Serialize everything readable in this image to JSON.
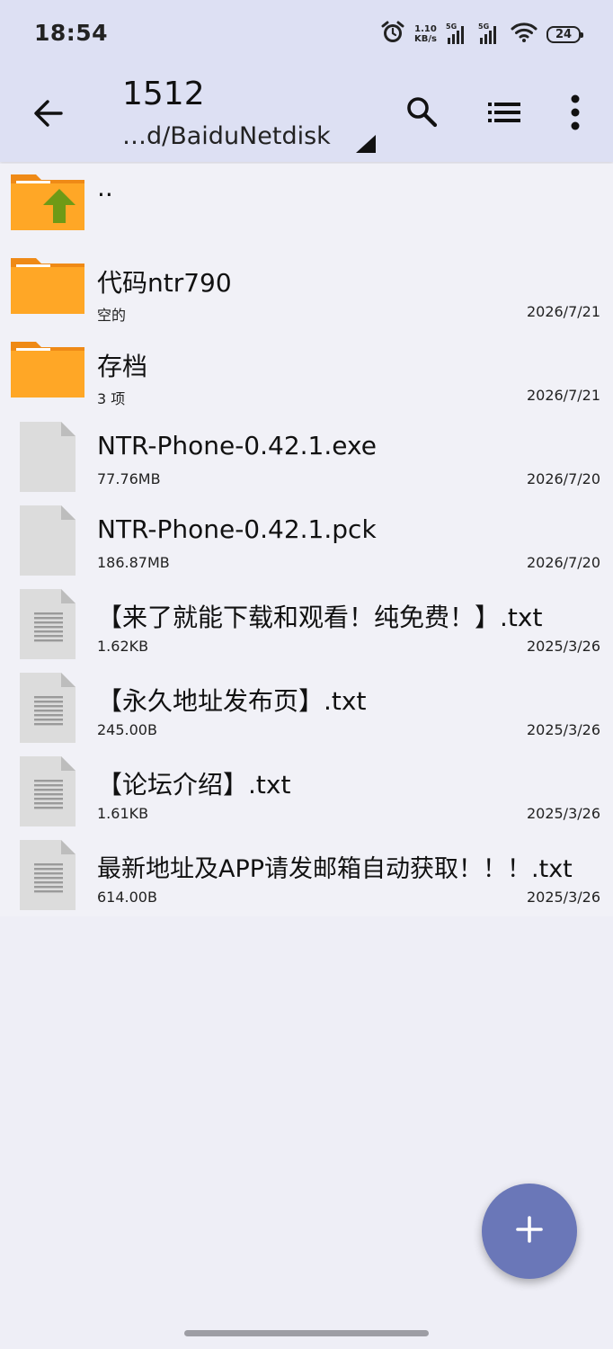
{
  "status_bar": {
    "time": "18:54",
    "net_speed_value": "1.10",
    "net_speed_unit": "KB/s",
    "sim1_label": "5G",
    "sim2_label": "5G",
    "battery": "24",
    "icons": [
      "alarm-icon",
      "signal-icon",
      "signal-icon",
      "wifi-icon",
      "battery-icon"
    ]
  },
  "appbar": {
    "title": "1512",
    "path": "…d/BaiduNetdisk",
    "icons": [
      "back-arrow-icon",
      "search-icon",
      "list-view-icon",
      "more-vert-icon"
    ]
  },
  "files": [
    {
      "type": "parent",
      "name": "..",
      "meta": "",
      "date": ""
    },
    {
      "type": "folder",
      "name": "代码ntr790",
      "meta": "空的",
      "date": "2026/7/21"
    },
    {
      "type": "folder",
      "name": "存档",
      "meta": "3 项",
      "date": "2026/7/21"
    },
    {
      "type": "file",
      "name": "NTR-Phone-0.42.1.exe",
      "meta": "77.76MB",
      "date": "2026/7/20"
    },
    {
      "type": "file",
      "name": "NTR-Phone-0.42.1.pck",
      "meta": "186.87MB",
      "date": "2026/7/20"
    },
    {
      "type": "text",
      "name": "【来了就能下载和观看！纯免费！】.txt",
      "meta": "1.62KB",
      "date": "2025/3/26"
    },
    {
      "type": "text",
      "name": "【永久地址发布页】.txt",
      "meta": "245.00B",
      "date": "2025/3/26"
    },
    {
      "type": "text",
      "name": "【论坛介绍】.txt",
      "meta": "1.61KB",
      "date": "2025/3/26"
    },
    {
      "type": "text",
      "name": "最新地址及APP请发邮箱自动获取！！！.txt",
      "meta": "614.00B",
      "date": "2025/3/26"
    }
  ],
  "fab": {
    "icon": "plus-icon"
  },
  "colors": {
    "header_bg": "#dde0f3",
    "folder_orange": "#ffa726",
    "parent_arrow_green": "#6e9a16",
    "fab_bg": "#6a77b8"
  }
}
